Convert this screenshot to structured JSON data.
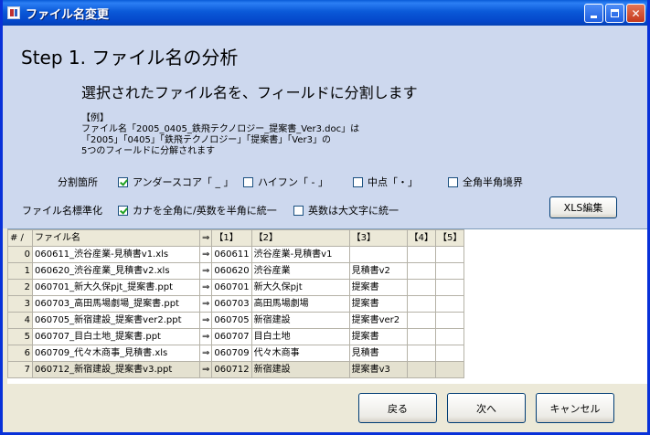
{
  "window": {
    "title": "ファイル名変更"
  },
  "step": {
    "title": "Step 1. ファイル名の分析",
    "subtitle": "選択されたファイル名を、フィールドに分割します"
  },
  "example": {
    "lines": [
      "【例】",
      "ファイル名「2005_0405_鉄飛テクノロジー_提案書_Ver3.doc」は",
      "「2005」「0405」「鉄飛テクノロジー」「提案書」「Ver3」の",
      "5つのフィールドに分解されます"
    ]
  },
  "split": {
    "label": "分割箇所",
    "options": [
      {
        "label": "アンダースコア「 _ 」",
        "checked": true
      },
      {
        "label": "ハイフン「 - 」",
        "checked": false
      },
      {
        "label": "中点「・」",
        "checked": false
      },
      {
        "label": "全角半角境界",
        "checked": false
      }
    ]
  },
  "normalize": {
    "label": "ファイル名標準化",
    "options": [
      {
        "label": "カナを全角に/英数を半角に統一",
        "checked": true
      },
      {
        "label": "英数は大文字に統一",
        "checked": false
      }
    ]
  },
  "xls_button": "XLS編集",
  "table": {
    "headers": [
      "# ∕",
      "ファイル名",
      "⇒",
      "【1】",
      "【2】",
      "【3】",
      "【4】",
      "【5】"
    ],
    "rows": [
      [
        "0",
        "060611_渋谷産業-見積書v1.xls",
        "⇒",
        "060611",
        "渋谷産業-見積書v1",
        "",
        "",
        ""
      ],
      [
        "1",
        "060620_渋谷産業_見積書v2.xls",
        "⇒",
        "060620",
        "渋谷産業",
        "見積書v2",
        "",
        ""
      ],
      [
        "2",
        "060701_新大久保pjt_提案書.ppt",
        "⇒",
        "060701",
        "新大久保pjt",
        "提案書",
        "",
        ""
      ],
      [
        "3",
        "060703_高田馬場劇場_提案書.ppt",
        "⇒",
        "060703",
        "高田馬場劇場",
        "提案書",
        "",
        ""
      ],
      [
        "4",
        "060705_新宿建設_提案書ver2.ppt",
        "⇒",
        "060705",
        "新宿建設",
        "提案書ver2",
        "",
        ""
      ],
      [
        "5",
        "060707_目白土地_提案書.ppt",
        "⇒",
        "060707",
        "目白土地",
        "提案書",
        "",
        ""
      ],
      [
        "6",
        "060709_代々木商事_見積書.xls",
        "⇒",
        "060709",
        "代々木商事",
        "見積書",
        "",
        ""
      ],
      [
        "7",
        "060712_新宿建設_提案書v3.ppt",
        "⇒",
        "060712",
        "新宿建設",
        "提案書v3",
        "",
        ""
      ]
    ]
  },
  "footer": {
    "back": "戻る",
    "next": "次へ",
    "cancel": "キャンセル"
  }
}
